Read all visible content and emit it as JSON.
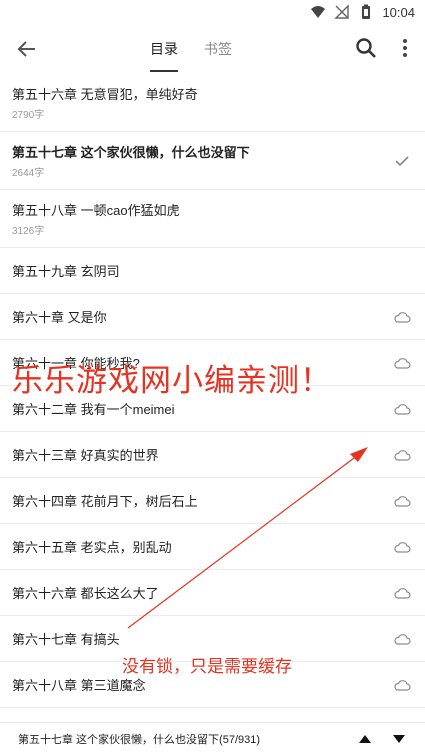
{
  "status_bar": {
    "icons": [
      "wifi-icon",
      "no-signal-icon",
      "battery-icon"
    ],
    "time": "10:04"
  },
  "toolbar": {
    "back_icon": "arrow-left-icon",
    "tabs": [
      {
        "label": "目录",
        "active": true
      },
      {
        "label": "书签",
        "active": false
      }
    ],
    "search_icon": "search-icon",
    "more_icon": "more-vertical-icon"
  },
  "chapters": [
    {
      "title": "第五十六章 无意冒犯，单纯好奇",
      "words": "2790字",
      "status": "none",
      "current": false
    },
    {
      "title": "第五十七章 这个家伙很懒，什么也没留下",
      "words": "2644字",
      "status": "check",
      "current": true
    },
    {
      "title": "第五十八章 一顿cao作猛如虎",
      "words": "3126字",
      "status": "none",
      "current": false
    },
    {
      "title": "第五十九章 玄阴司",
      "words": "",
      "status": "none",
      "current": false
    },
    {
      "title": "第六十章 又是你",
      "words": "",
      "status": "cloud",
      "current": false
    },
    {
      "title": "第六十一章 你能秒我?",
      "words": "",
      "status": "cloud",
      "current": false
    },
    {
      "title": "第六十二章 我有一个meimei",
      "words": "",
      "status": "cloud",
      "current": false
    },
    {
      "title": "第六十三章 好真实的世界",
      "words": "",
      "status": "cloud",
      "current": false
    },
    {
      "title": "第六十四章 花前月下，树后石上",
      "words": "",
      "status": "cloud",
      "current": false
    },
    {
      "title": "第六十五章 老实点，别乱动",
      "words": "",
      "status": "cloud",
      "current": false
    },
    {
      "title": "第六十六章 都长这么大了",
      "words": "",
      "status": "cloud",
      "current": false
    },
    {
      "title": "第六十七章 有搞头",
      "words": "",
      "status": "cloud",
      "current": false
    },
    {
      "title": "第六十八章 第三道魔念",
      "words": "",
      "status": "cloud",
      "current": false
    }
  ],
  "annotations": {
    "big": "乐乐游戏网小编亲测！",
    "small": "没有锁，只是需要缓存",
    "color": "#e53322"
  },
  "bottom_bar": {
    "current_label": "第五十七章 这个家伙很懒，什么也没留下(57/931)",
    "prev_icon": "triangle-up-icon",
    "next_icon": "triangle-down-icon"
  }
}
